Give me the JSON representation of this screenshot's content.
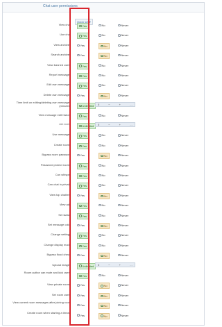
{
  "panel": {
    "title": "Chat user permissions"
  },
  "toolbar": {
    "quick_set": "Quick set ▾"
  },
  "labels": {
    "yes": "Yes",
    "no": "No",
    "never": "Never",
    "unlimited": "Unlimited"
  },
  "numbox": {
    "value": "0",
    "minus": "−",
    "plus": "+",
    "more": "…"
  },
  "rows": [
    {
      "label": "View chat",
      "yes": "Yes",
      "no": "No",
      "never": "Never",
      "selected": "yes"
    },
    {
      "label": "Use chat",
      "yes": "Yes",
      "no": "No",
      "never": "Never",
      "selected": "yes"
    },
    {
      "label": "View archives",
      "yes": "Yes",
      "no": "No",
      "never": "Never",
      "selected": "no"
    },
    {
      "label": "Search archives",
      "yes": "Yes",
      "no": "No",
      "never": "Never",
      "selected": "no"
    },
    {
      "label": "View banned users",
      "yes": "Yes",
      "no": "No",
      "never": "Never",
      "selected": "yes"
    },
    {
      "label": "Report messages",
      "yes": "Yes",
      "no": "No",
      "never": "Never",
      "selected": "yes"
    },
    {
      "label": "Edit own messages",
      "yes": "Yes",
      "no": "No",
      "never": "Never",
      "selected": "yes"
    },
    {
      "label": "Delete own messages",
      "yes": "Yes",
      "no": "No",
      "never": "Never",
      "selected": "no"
    },
    {
      "label": "Time limit on editing/deleting own messages (minutes)",
      "type": "number",
      "unlimited": "Unlimited"
    },
    {
      "label": "View message edit history",
      "yes": "Yes",
      "no": "No",
      "never": "Never",
      "selected": "yes"
    },
    {
      "label": "Join rooms",
      "type": "number",
      "unlimited": "Unlimited",
      "small": true
    },
    {
      "label": "Use messages",
      "yes": "Yes",
      "no": "No",
      "never": "Never",
      "selected": "yes"
    },
    {
      "label": "Create rooms",
      "yes": "Yes",
      "no": "No",
      "never": "Never",
      "selected": "yes"
    },
    {
      "label": "Bypass room password",
      "yes": "Yes",
      "no": "No",
      "never": "Never",
      "selected": "no"
    },
    {
      "label": "Password protect rooms",
      "yes": "Yes",
      "no": "No",
      "never": "Never",
      "selected": "yes"
    },
    {
      "label": "Can whisper",
      "yes": "Yes",
      "no": "No",
      "never": "Never",
      "selected": "yes"
    },
    {
      "label": "Can chat in private",
      "yes": "Yes",
      "no": "No",
      "never": "Never",
      "selected": "yes"
    },
    {
      "label": "View top chatters",
      "yes": "Yes",
      "no": "No",
      "never": "Never",
      "selected": "no"
    },
    {
      "label": "View ads",
      "yes": "Yes",
      "no": "No",
      "never": "Never",
      "selected": "yes"
    },
    {
      "label": "Set status",
      "yes": "Yes",
      "no": "No",
      "never": "Never",
      "selected": "yes"
    },
    {
      "label": "Set message color",
      "yes": "Yes",
      "no": "No",
      "never": "Never",
      "selected": "no"
    },
    {
      "label": "Change settings",
      "yes": "Yes",
      "no": "No",
      "never": "Never",
      "selected": "yes"
    },
    {
      "label": "Change display mode",
      "yes": "Yes",
      "no": "No",
      "never": "Never",
      "selected": "yes"
    },
    {
      "label": "Bypass flood check",
      "yes": "Yes",
      "no": "No",
      "never": "Never",
      "selected": "no"
    },
    {
      "label": "Upload images",
      "type": "number",
      "unlimited": "Unlimited"
    },
    {
      "label": "Room author can mute and kick users",
      "yes": "Yes",
      "no": "No",
      "never": "Never",
      "selected": "yes"
    },
    {
      "label": "View private rooms",
      "yes": "Yes",
      "no": "No",
      "never": "Never",
      "selected": "no"
    },
    {
      "label": "Set room users",
      "yes": "Yes",
      "no": "No",
      "never": "Never",
      "selected": "no"
    },
    {
      "label": "View current room messages after joining room",
      "yes": "Yes",
      "no": "No",
      "never": "Never",
      "selected": "no"
    },
    {
      "label": "Create room when starting a thread",
      "yes": "Yes",
      "no": "No",
      "never": "Never",
      "selected": "no"
    }
  ]
}
